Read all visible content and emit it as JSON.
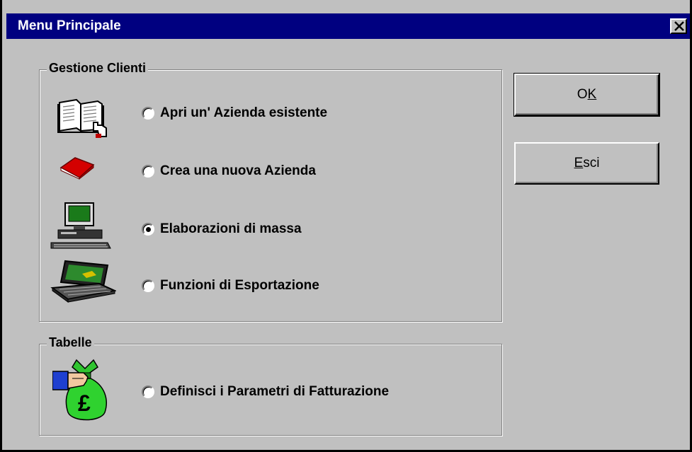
{
  "window": {
    "title": "Menu Principale"
  },
  "gestione_clienti": {
    "title": "Gestione Clienti",
    "options": [
      {
        "label": "Apri un' Azienda esistente",
        "icon": "open-book-icon",
        "checked": false
      },
      {
        "label": "Crea una nuova Azienda",
        "icon": "red-book-icon",
        "checked": false
      },
      {
        "label": "Elaborazioni di massa",
        "icon": "desktop-computer-icon",
        "checked": true
      },
      {
        "label": "Funzioni di Esportazione",
        "icon": "laptop-icon",
        "checked": false
      }
    ]
  },
  "tabelle": {
    "title": "Tabelle",
    "options": [
      {
        "label": "Definisci  i Parametri di Fatturazione",
        "icon": "money-bag-icon",
        "checked": false
      }
    ]
  },
  "buttons": {
    "ok": {
      "mnemonic": "K",
      "prefix": "O",
      "suffix": ""
    },
    "esci": {
      "mnemonic": "E",
      "prefix": "",
      "suffix": "sci"
    }
  }
}
